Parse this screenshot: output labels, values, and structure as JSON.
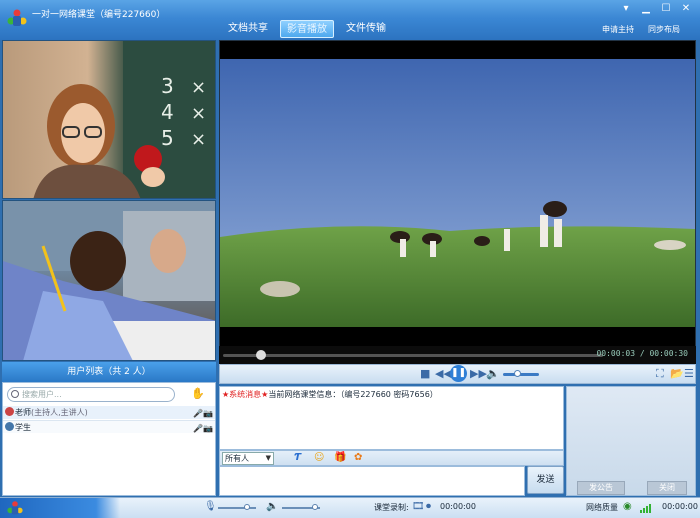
{
  "app": {
    "title": "一对一网络课堂（编号227660）"
  },
  "nav_tabs": [
    {
      "label": "文档共享",
      "active": false
    },
    {
      "label": "影音播放",
      "active": true
    },
    {
      "label": "文件传输",
      "active": false
    }
  ],
  "top_links": {
    "apply_host": "申请主持",
    "sync_layout": "同步布局"
  },
  "user_list": {
    "title": "用户列表（共 2 人）",
    "search_placeholder": "搜索用户...",
    "users": [
      {
        "name": "老师",
        "role": "(主持人,主讲人)"
      },
      {
        "name": "学生",
        "role": ""
      }
    ]
  },
  "player": {
    "time_display": "00:00:03 / 00:00:30",
    "progress": 0.1
  },
  "chat": {
    "system_label": "★系统消息★",
    "system_message": "当前网络课堂信息：（编号227660 密码7656）",
    "recipient": "所有人",
    "send_label": "发送"
  },
  "notice": {
    "publish_label": "发公告",
    "close_label": "关闭"
  },
  "status_bar": {
    "record_label": "课堂录制:",
    "record_time": "00:00:00",
    "quality_label": "网络质量",
    "quality_time": "00:00:00"
  },
  "colors": {
    "accent": "#2f7fd6",
    "system_message": "#e02020",
    "signal": "#33b233"
  }
}
